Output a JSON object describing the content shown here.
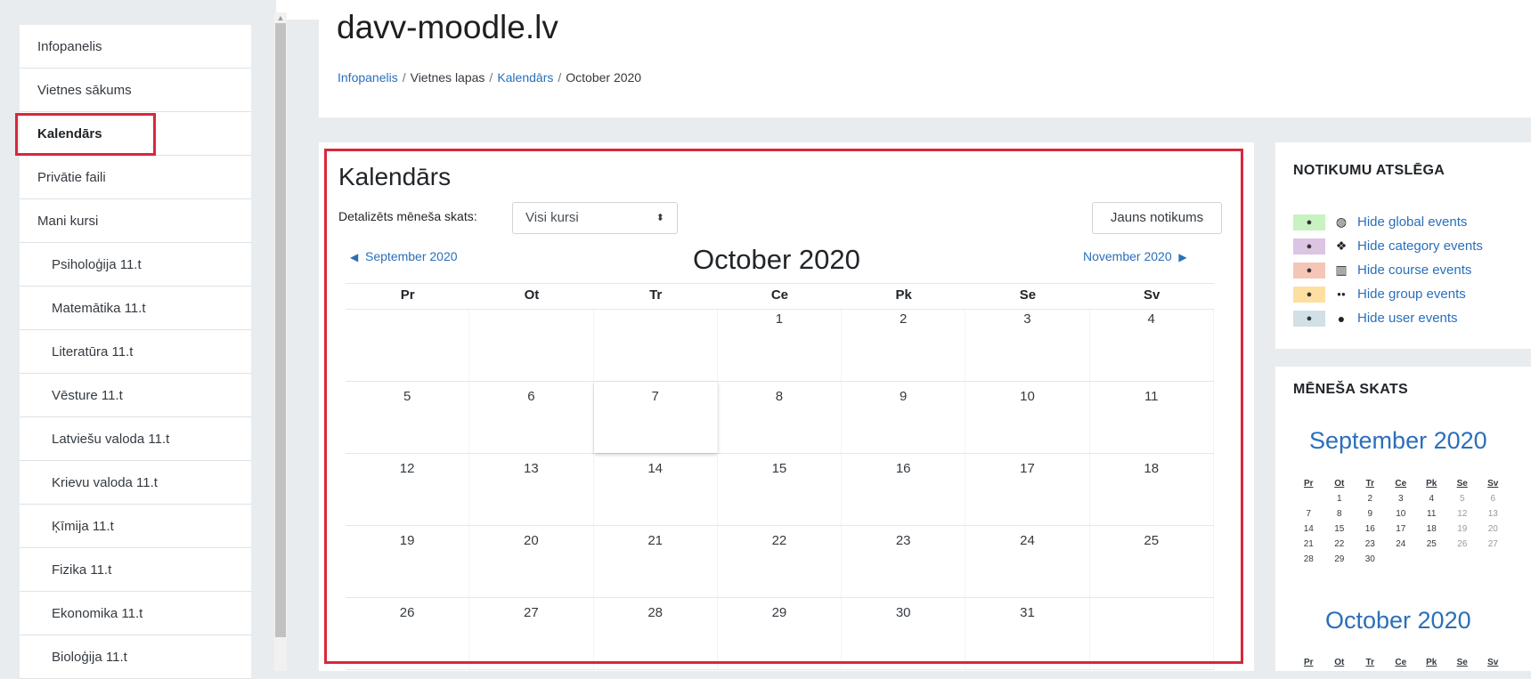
{
  "site": {
    "title": "davv-moodle.lv",
    "breadcrumb": [
      "Infopanelis",
      "Vietnes lapas",
      "Kalendārs",
      "October 2020"
    ]
  },
  "nav": {
    "items": [
      {
        "label": "Infopanelis"
      },
      {
        "label": "Vietnes sākums"
      },
      {
        "label": "Kalendārs",
        "active": true
      },
      {
        "label": "Privātie faili"
      },
      {
        "label": "Mani kursi"
      },
      {
        "label": "Psiholoģija 11.t"
      },
      {
        "label": "Matemātika 11.t"
      },
      {
        "label": "Literatūra 11.t"
      },
      {
        "label": "Vēsture 11.t"
      },
      {
        "label": "Latviešu valoda 11.t"
      },
      {
        "label": "Krievu valoda 11.t"
      },
      {
        "label": "Ķīmija 11.t"
      },
      {
        "label": "Fizika 11.t"
      },
      {
        "label": "Ekonomika 11.t"
      },
      {
        "label": "Bioloģija 11.t"
      }
    ]
  },
  "calendar": {
    "heading": "Kalendārs",
    "view_label": "Detalizēts mēneša skats:",
    "course_select": "Visi kursi",
    "new_event_button": "Jauns notikums",
    "prev_month": "September 2020",
    "next_month": "November 2020",
    "current_month": "October 2020",
    "weekdays": [
      "Pr",
      "Ot",
      "Tr",
      "Ce",
      "Pk",
      "Se",
      "Sv"
    ],
    "weeks": [
      [
        "",
        "",
        "",
        "1",
        "2",
        "3",
        "4"
      ],
      [
        "5",
        "6",
        "7",
        "8",
        "9",
        "10",
        "11"
      ],
      [
        "12",
        "13",
        "14",
        "15",
        "16",
        "17",
        "18"
      ],
      [
        "19",
        "20",
        "21",
        "22",
        "23",
        "24",
        "25"
      ],
      [
        "26",
        "27",
        "28",
        "29",
        "30",
        "31",
        ""
      ]
    ],
    "today": "7"
  },
  "event_key": {
    "title": "NOTIKUMU ATSLĒGA",
    "items": [
      {
        "label": "Hide global events",
        "icon": "globe-icon",
        "color": "#c9f2c2"
      },
      {
        "label": "Hide category events",
        "icon": "cubes-icon",
        "color": "#dcc4e3"
      },
      {
        "label": "Hide course events",
        "icon": "institution-icon",
        "color": "#f5c6b6"
      },
      {
        "label": "Hide group events",
        "icon": "group-icon",
        "color": "#fde0a1"
      },
      {
        "label": "Hide user events",
        "icon": "user-icon",
        "color": "#d0e0e6"
      }
    ]
  },
  "month_view": {
    "title": "MĒNEŠA SKATS",
    "months": [
      {
        "name": "September 2020",
        "weekdays": [
          "Pr",
          "Ot",
          "Tr",
          "Ce",
          "Pk",
          "Se",
          "Sv"
        ],
        "weeks": [
          [
            "",
            "1",
            "2",
            "3",
            "4",
            "5",
            "6"
          ],
          [
            "7",
            "8",
            "9",
            "10",
            "11",
            "12",
            "13"
          ],
          [
            "14",
            "15",
            "16",
            "17",
            "18",
            "19",
            "20"
          ],
          [
            "21",
            "22",
            "23",
            "24",
            "25",
            "26",
            "27"
          ],
          [
            "28",
            "29",
            "30",
            "",
            "",
            "",
            ""
          ]
        ]
      },
      {
        "name": "October 2020",
        "weekdays": [
          "Pr",
          "Ot",
          "Tr",
          "Ce",
          "Pk",
          "Se",
          "Sv"
        ],
        "weeks": []
      }
    ]
  },
  "colors": {
    "link": "#2a6fbb",
    "highlight": "#d7283a"
  }
}
